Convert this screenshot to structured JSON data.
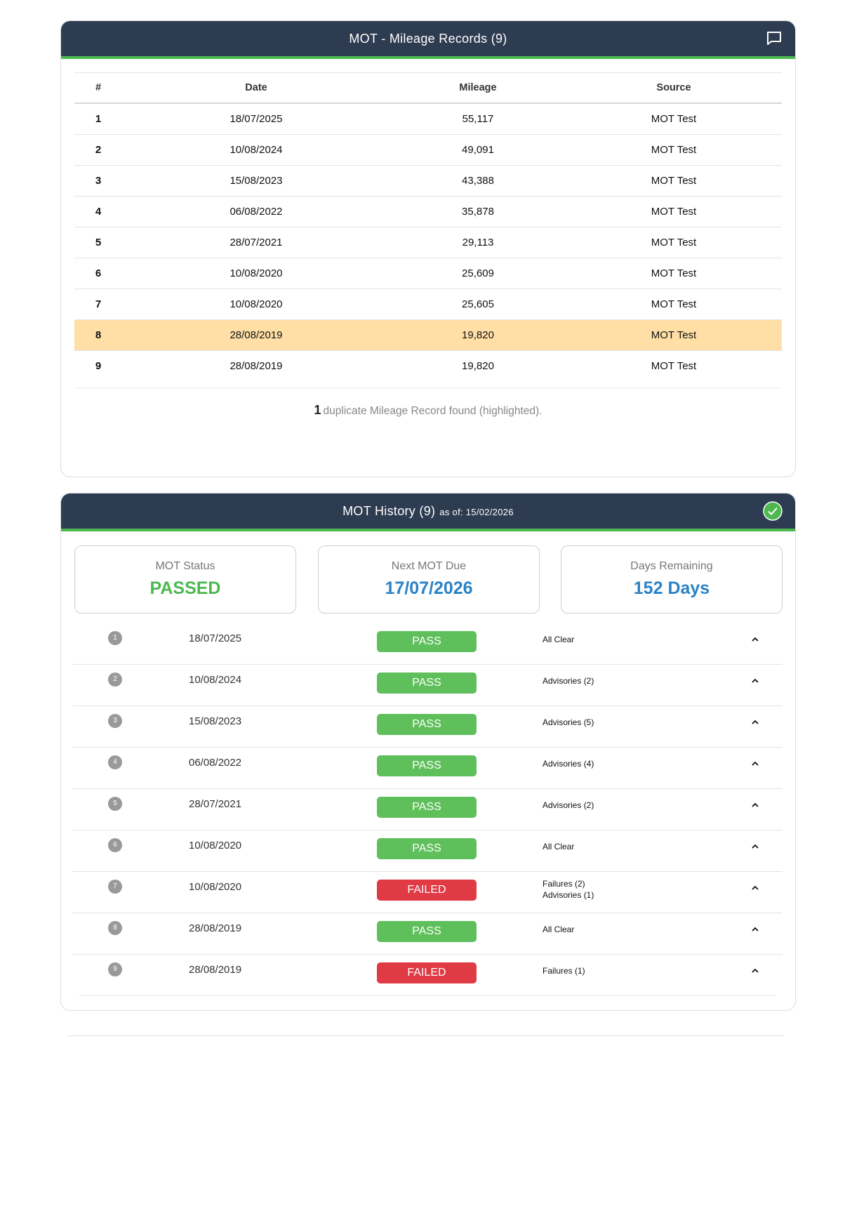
{
  "mileage": {
    "title": "MOT - Mileage Records (9)",
    "icon": "comment-icon",
    "columns": [
      "#",
      "Date",
      "Mileage",
      "Source"
    ],
    "rows": [
      {
        "n": "1",
        "date": "18/07/2025",
        "mileage": "55,117",
        "source": "MOT Test"
      },
      {
        "n": "2",
        "date": "10/08/2024",
        "mileage": "49,091",
        "source": "MOT Test"
      },
      {
        "n": "3",
        "date": "15/08/2023",
        "mileage": "43,388",
        "source": "MOT Test"
      },
      {
        "n": "4",
        "date": "06/08/2022",
        "mileage": "35,878",
        "source": "MOT Test"
      },
      {
        "n": "5",
        "date": "28/07/2021",
        "mileage": "29,113",
        "source": "MOT Test"
      },
      {
        "n": "6",
        "date": "10/08/2020",
        "mileage": "25,609",
        "source": "MOT Test"
      },
      {
        "n": "7",
        "date": "10/08/2020",
        "mileage": "25,605",
        "source": "MOT Test"
      },
      {
        "n": "8",
        "date": "28/08/2019",
        "mileage": "19,820",
        "source": "MOT Test",
        "highlighted": true
      },
      {
        "n": "9",
        "date": "28/08/2019",
        "mileage": "19,820",
        "source": "MOT Test"
      }
    ],
    "duplicate_count": "1",
    "duplicate_text": "duplicate Mileage Record found (highlighted)."
  },
  "history": {
    "title": "MOT History (9)",
    "as_of": "as of: 15/02/2026",
    "icon": "check-circle-icon",
    "status_label": "MOT Status",
    "status_value": "PASSED",
    "next_due_label": "Next MOT Due",
    "next_due_value": "17/07/2026",
    "days_label": "Days Remaining",
    "days_value": "152 Days",
    "colors": {
      "pass": "#5fbf5b",
      "fail": "#e03a44",
      "accent": "#4cb84e",
      "header": "#2e3c52"
    },
    "rows": [
      {
        "n": "1",
        "date": "18/07/2025",
        "result": "PASS",
        "notes": [
          "All Clear"
        ]
      },
      {
        "n": "2",
        "date": "10/08/2024",
        "result": "PASS",
        "notes": [
          "Advisories (2)"
        ]
      },
      {
        "n": "3",
        "date": "15/08/2023",
        "result": "PASS",
        "notes": [
          "Advisories (5)"
        ]
      },
      {
        "n": "4",
        "date": "06/08/2022",
        "result": "PASS",
        "notes": [
          "Advisories (4)"
        ]
      },
      {
        "n": "5",
        "date": "28/07/2021",
        "result": "PASS",
        "notes": [
          "Advisories (2)"
        ]
      },
      {
        "n": "6",
        "date": "10/08/2020",
        "result": "PASS",
        "notes": [
          "All Clear"
        ]
      },
      {
        "n": "7",
        "date": "10/08/2020",
        "result": "FAILED",
        "notes": [
          "Failures (2)",
          "Advisories (1)"
        ]
      },
      {
        "n": "8",
        "date": "28/08/2019",
        "result": "PASS",
        "notes": [
          "All Clear"
        ]
      },
      {
        "n": "9",
        "date": "28/08/2019",
        "result": "FAILED",
        "notes": [
          "Failures (1)"
        ]
      }
    ]
  }
}
